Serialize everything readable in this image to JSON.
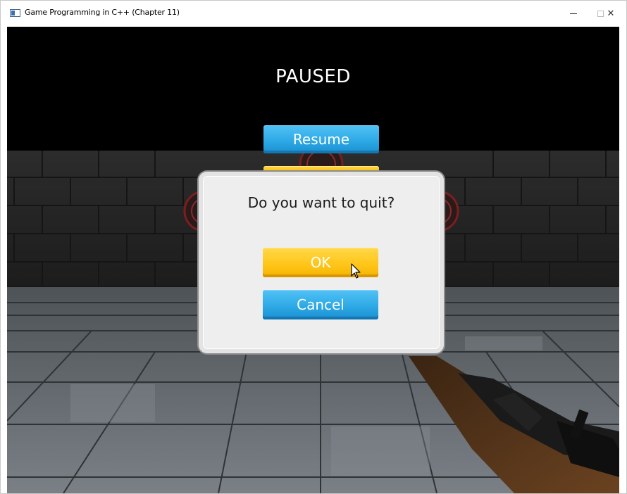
{
  "window": {
    "title": "Game Programming in C++ (Chapter 11)",
    "controls": [
      "minimize",
      "maximize",
      "close"
    ],
    "close_label": "✕"
  },
  "pause_menu": {
    "title": "PAUSED",
    "resume_label": "Resume"
  },
  "quit_dialog": {
    "message": "Do you want to quit?",
    "ok_label": "OK",
    "cancel_label": "Cancel"
  },
  "colors": {
    "button_blue": "#2ea9e6",
    "button_yellow": "#ffc61a",
    "dialog_bg": "#eeeeee",
    "sky": "#000000"
  },
  "icons": {
    "app": "window-app-icon",
    "cursor": "mouse-pointer-icon"
  }
}
